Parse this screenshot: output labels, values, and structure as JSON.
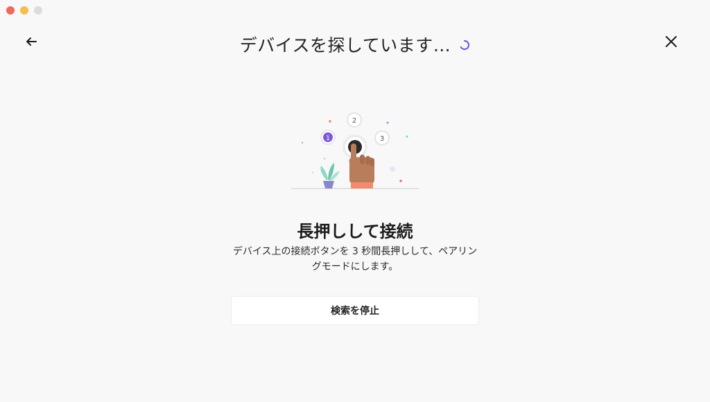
{
  "window": {
    "controls": [
      "close",
      "minimize",
      "maximize"
    ]
  },
  "header": {
    "title": "デバイスを探しています…",
    "back_icon": "arrow-left-icon",
    "close_icon": "close-icon",
    "spinner_color": "#7b5cd6"
  },
  "illustration": {
    "steps": [
      "1",
      "2",
      "3"
    ],
    "accent": "#7b5cd6"
  },
  "main": {
    "heading": "長押しして接続",
    "description": "デバイス上の接続ボタンを 3 秒間長押しして、ペアリングモードにします。",
    "stop_button_label": "検索を停止"
  }
}
